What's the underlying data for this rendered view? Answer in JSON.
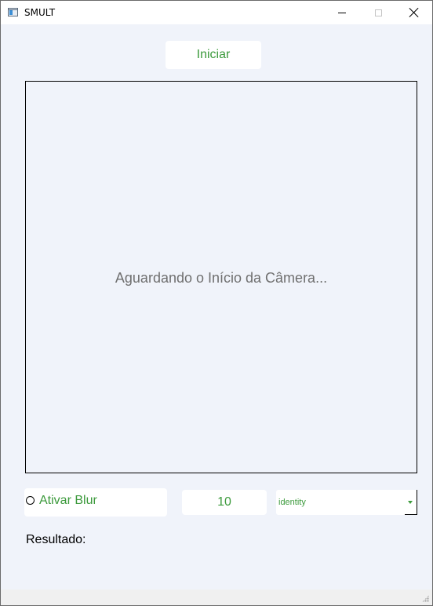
{
  "window": {
    "title": "SMULT"
  },
  "controls": {
    "start_label": "Iniciar",
    "camera_status": "Aguardando o Início da Câmera...",
    "blur_label": "Ativar Blur",
    "blur_checked": false,
    "blur_value": "10",
    "filter_selected": "identity",
    "result_label": "Resultado:"
  },
  "icons": {
    "app": "window-app-icon",
    "minimize": "minimize-icon",
    "maximize": "maximize-icon",
    "close": "close-icon",
    "dropdown": "chevron-down-icon",
    "grip": "size-grip-icon"
  },
  "colors": {
    "accent_text": "#3c9a3c",
    "window_bg": "#f0f3fa",
    "status_text": "#6f6f6f"
  }
}
